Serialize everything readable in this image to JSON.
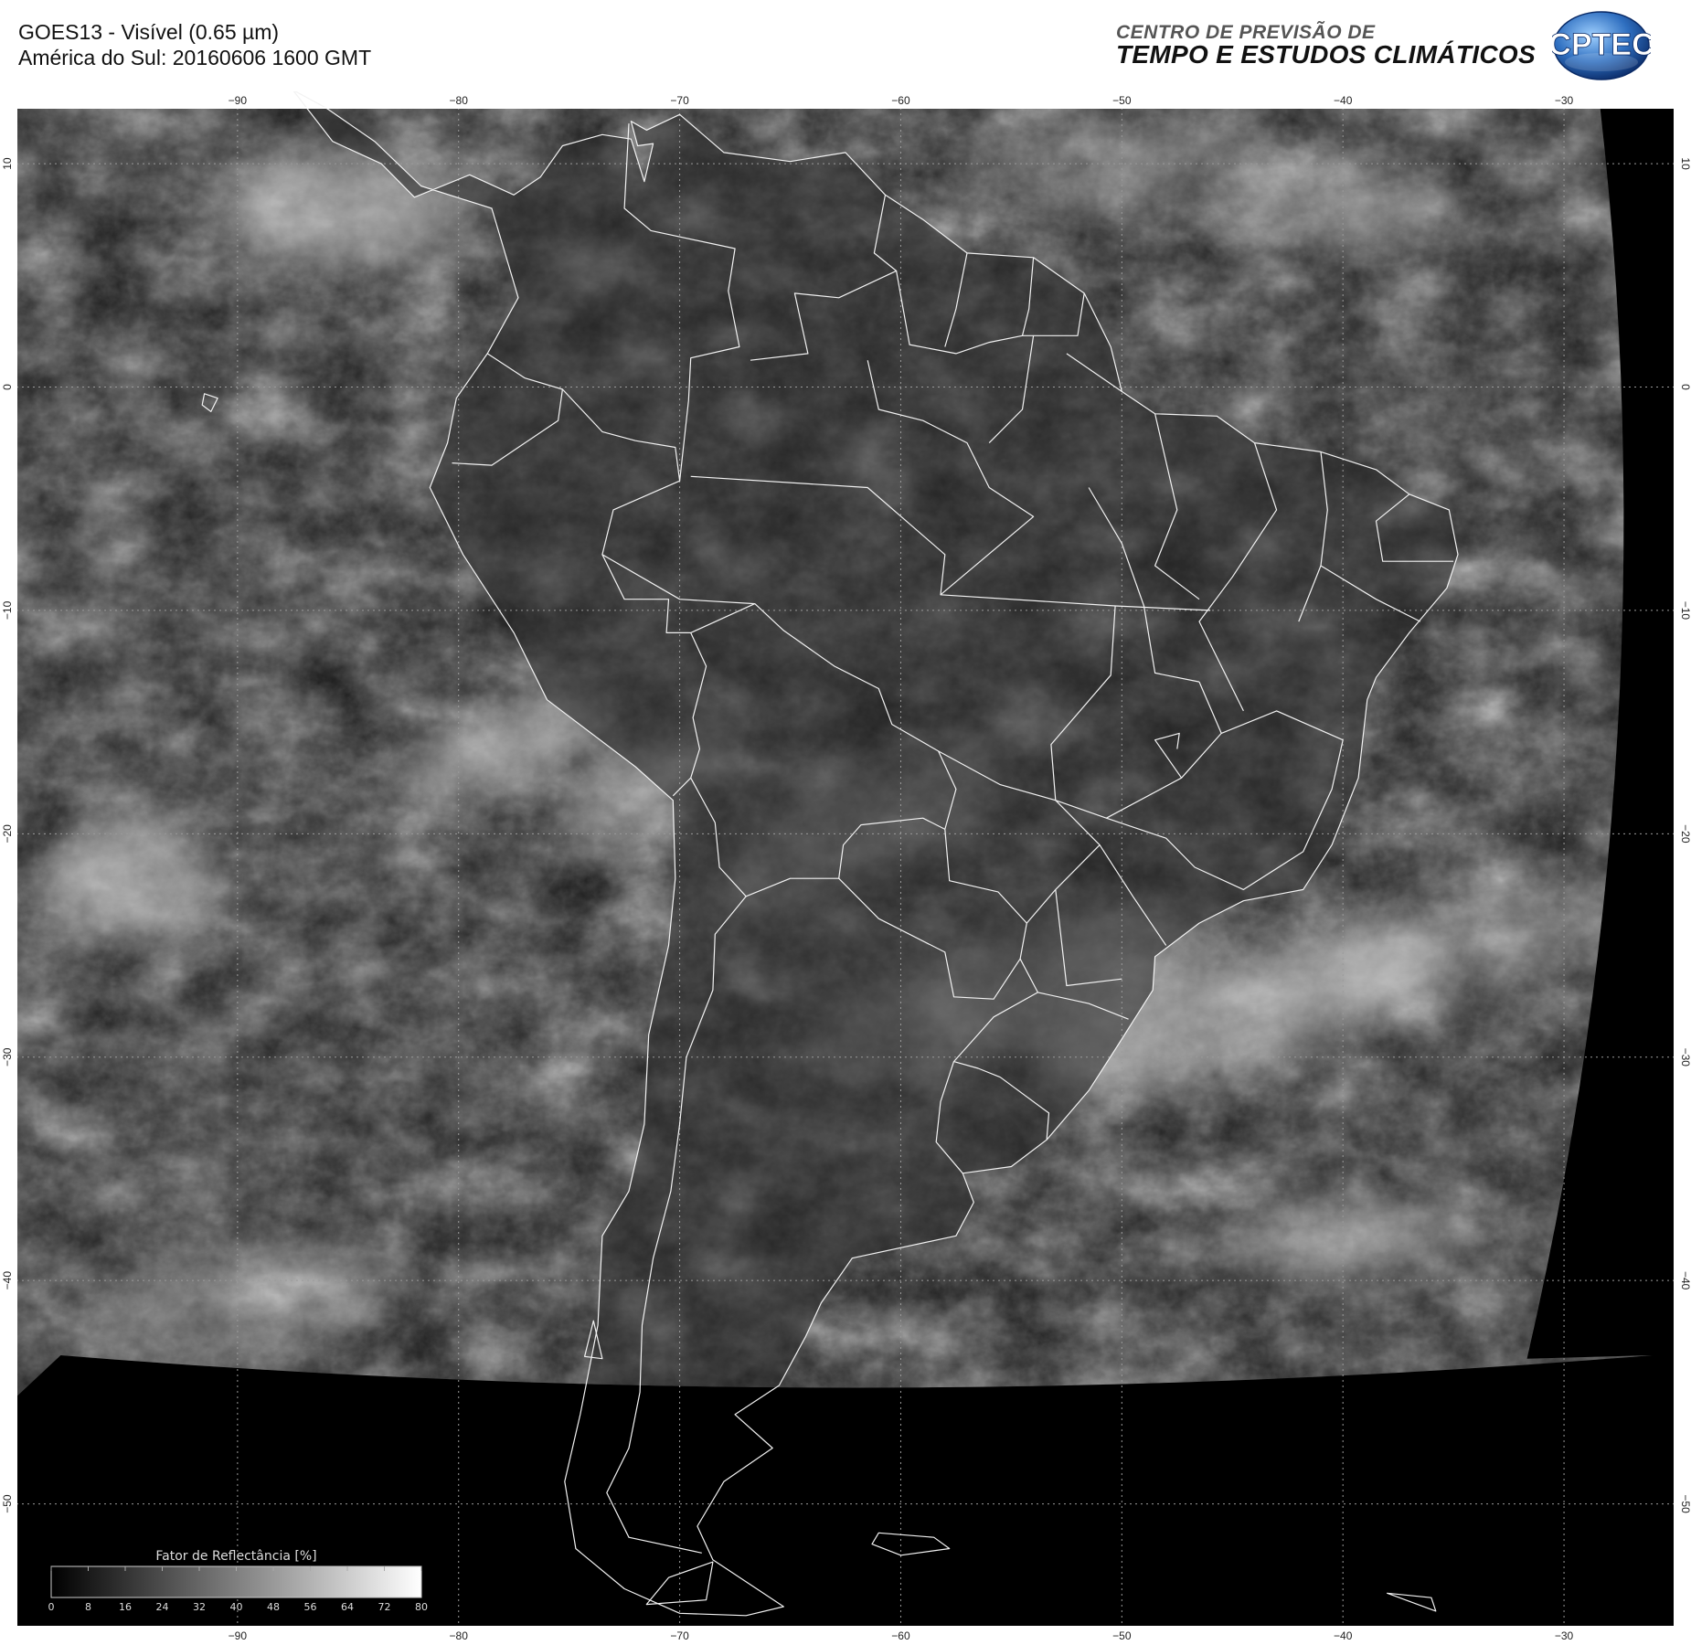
{
  "header": {
    "title_line1": "GOES13 - Visível (0.65 µm)",
    "title_line2": "América do Sul: 20160606 1600 GMT",
    "org_line1": "CENTRO DE PREVISÃO DE",
    "org_line2": "TEMPO E ESTUDOS CLIMÁTICOS",
    "logo_text": "CPTEC"
  },
  "map": {
    "lon_range": [
      -100,
      -25
    ],
    "lat_range": [
      -55.5,
      12.5
    ],
    "lon_ticks": [
      -90,
      -80,
      -70,
      -60,
      -50,
      -40,
      -30
    ],
    "lat_ticks": [
      10,
      0,
      -10,
      -20,
      -30,
      -40,
      -50
    ],
    "lon_tick_labels": [
      "−90",
      "−80",
      "−70",
      "−60",
      "−50",
      "−40",
      "−30"
    ],
    "lat_tick_labels": [
      "10",
      "0",
      "−10",
      "−20",
      "−30",
      "−40",
      "−50"
    ],
    "grid": true,
    "colors": {
      "frame": "#ffffff",
      "grid": "#9a9a9a",
      "borders": "#f2f2f2",
      "no_data": "#000000"
    }
  },
  "legend": {
    "title": "Fator de Reflectância [%]",
    "ticks": [
      "0",
      "8",
      "16",
      "24",
      "32",
      "40",
      "48",
      "56",
      "64",
      "72",
      "80"
    ],
    "min": 0,
    "max": 80,
    "placement": "bottom-left"
  }
}
